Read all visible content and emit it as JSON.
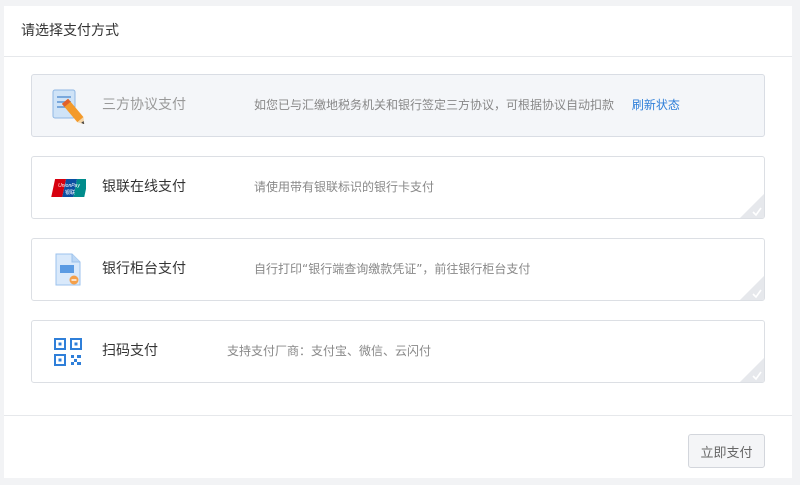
{
  "panel": {
    "title": "请选择支付方式"
  },
  "options": [
    {
      "name": "three-party-agreement",
      "title": "三方协议支付",
      "desc": "如您已与汇缴地税务机关和银行签定三方协议，可根据协议自动扣款",
      "link": "刷新状态",
      "icon": "document-edit-icon",
      "disabled": true
    },
    {
      "name": "unionpay-online",
      "title": "银联在线支付",
      "desc": "请使用带有银联标识的银行卡支付",
      "icon": "unionpay-card-icon",
      "card_brand": "UnionPay",
      "card_sub": "银联",
      "disabled": false
    },
    {
      "name": "bank-counter",
      "title": "银行柜台支付",
      "desc": "自行打印“银行端查询缴款凭证”，前往银行柜台支付",
      "icon": "bank-voucher-icon",
      "disabled": false
    },
    {
      "name": "qr-code",
      "title": "扫码支付",
      "desc": "支持支付厂商：支付宝、微信、云闪付",
      "icon": "qr-code-icon",
      "disabled": false
    }
  ],
  "footer": {
    "pay_button": "立即支付"
  },
  "colors": {
    "link": "#2f7fd9",
    "border": "#dcdfe4",
    "disabled_bg": "#f4f6f9",
    "unionpay_red": "#d7000f",
    "unionpay_blue": "#0b4ea2",
    "unionpay_green": "#008c8c"
  }
}
